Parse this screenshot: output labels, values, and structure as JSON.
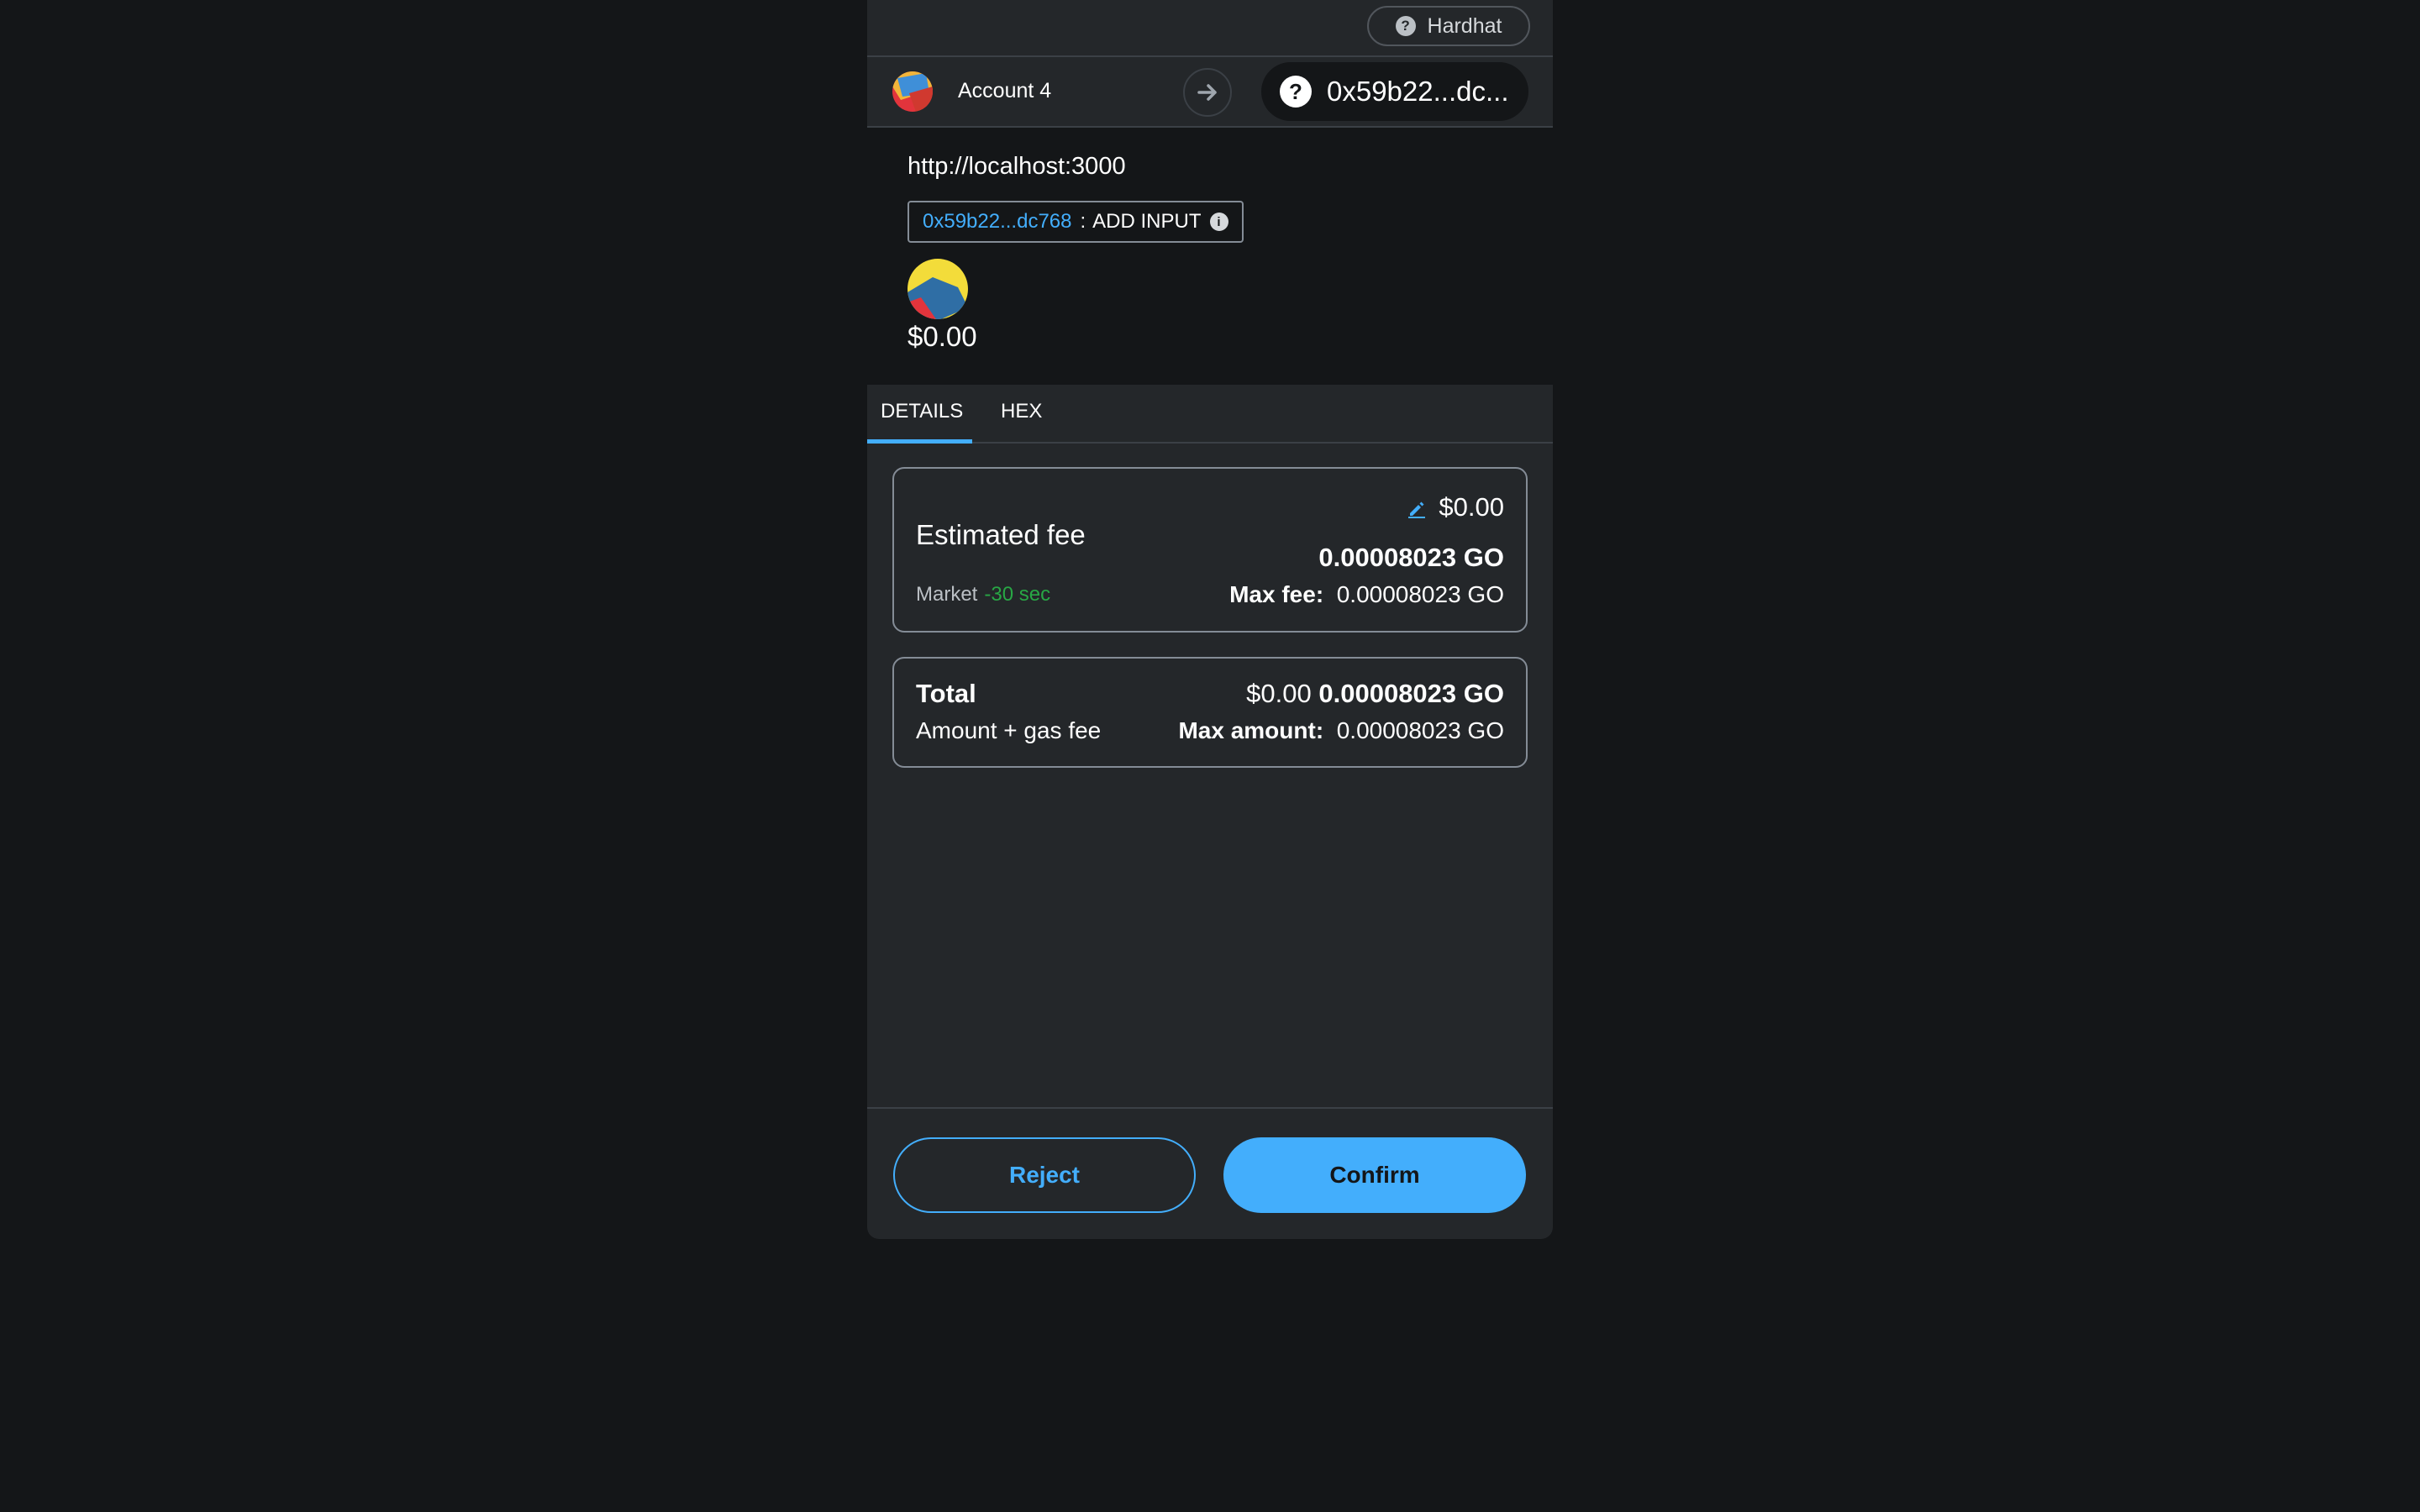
{
  "network": {
    "label": "Hardhat",
    "icon": "question-icon"
  },
  "account": {
    "name": "Account 4"
  },
  "recipient": {
    "label": "0x59b22...dc..."
  },
  "origin": {
    "url": "http://localhost:3000"
  },
  "method": {
    "address": "0x59b22...dc768",
    "separator": ":",
    "name": "ADD INPUT"
  },
  "value": {
    "fiat": "$0.00"
  },
  "tabs": [
    {
      "label": "DETAILS",
      "active": true
    },
    {
      "label": "HEX",
      "active": false
    }
  ],
  "fee": {
    "title": "Estimated fee",
    "fiat": "$0.00",
    "native": "0.00008023 GO",
    "market_label": "Market",
    "market_time": "-30 sec",
    "max_label": "Max fee:",
    "max_value": "0.00008023 GO"
  },
  "total": {
    "title": "Total",
    "subtitle": "Amount + gas fee",
    "fiat": "$0.00",
    "native": "0.00008023 GO",
    "max_label": "Max amount:",
    "max_value": "0.00008023 GO"
  },
  "buttons": {
    "reject": "Reject",
    "confirm": "Confirm"
  },
  "colors": {
    "background": "#141618",
    "panel": "#24272a",
    "accent": "#43aefc",
    "success": "#28a745",
    "border": "#848c96"
  }
}
